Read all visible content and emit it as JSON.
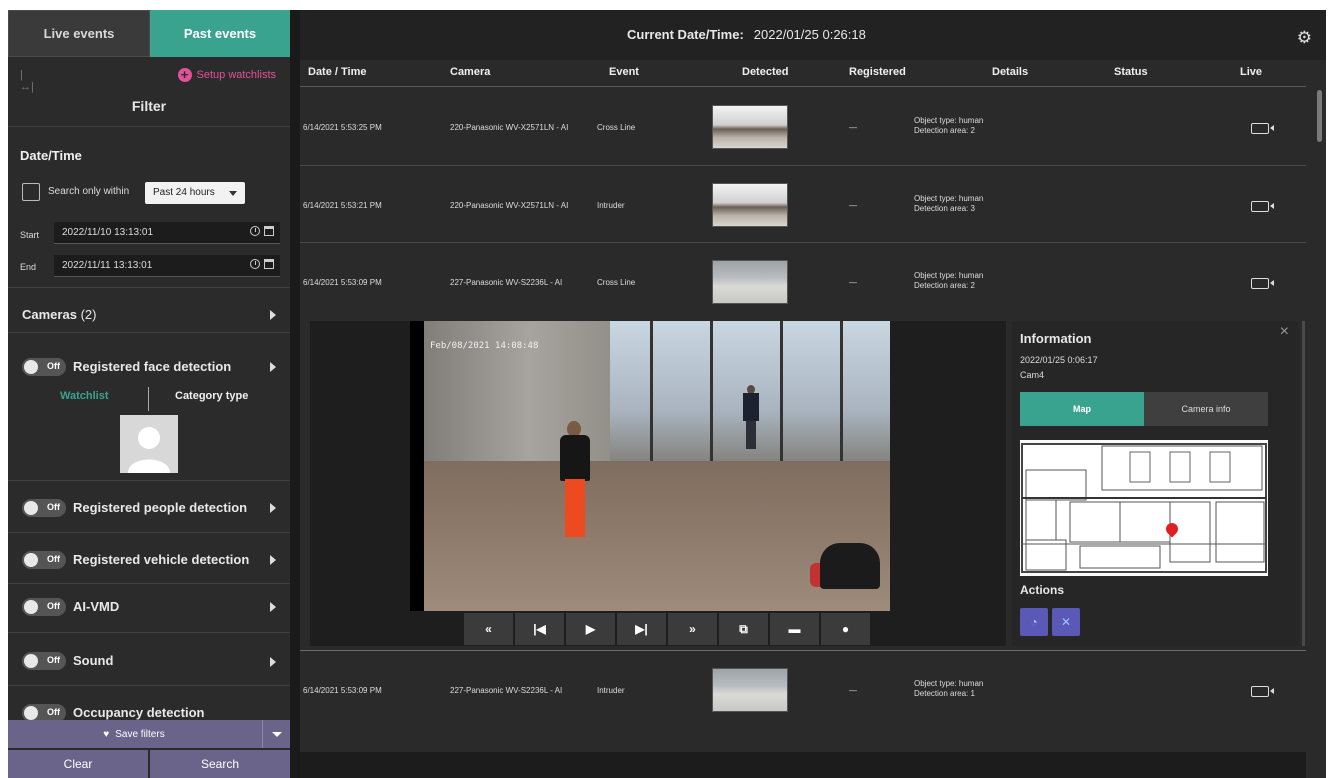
{
  "left": {
    "tabs": {
      "live": "Live events",
      "past": "Past events"
    },
    "setup_watchlists": "Setup watchlists",
    "filter_title": "Filter",
    "datetime": {
      "title": "Date/Time",
      "search_within_label": "Search only within",
      "range_value": "Past 24 hours",
      "start_label": "Start",
      "start_value": "2022/11/10   13:13:01",
      "end_label": "End",
      "end_value": "2022/11/11   13:13:01"
    },
    "cameras": {
      "label": "Cameras",
      "count": "(2)"
    },
    "toggle_off_text": "Off",
    "sections": {
      "face": "Registered face detection",
      "people": "Registered people detection",
      "vehicle": "Registered vehicle detection",
      "aivmd": "AI-VMD",
      "sound": "Sound",
      "occupancy": "Occupancy detection"
    },
    "watchlist_tab": "Watchlist",
    "category_tab": "Category type",
    "save_filters": "Save filters",
    "clear": "Clear",
    "search": "Search",
    "colors": {
      "accent": "#3aa38f",
      "pink": "#e0539a",
      "button": "#6a638a"
    }
  },
  "header": {
    "current_label": "Current Date/Time:",
    "current_value": "2022/01/25 0:26:18"
  },
  "columns": [
    "Date / Time",
    "Camera",
    "Event",
    "Detected",
    "Registered",
    "Details",
    "Status",
    "Live"
  ],
  "rows": [
    {
      "datetime": "6/14/2021 5:53:25 PM",
      "camera": "220-Panasonic WV-X2571LN - AI",
      "event": "Cross Line",
      "registered": "—",
      "details_1": "Object type: human",
      "details_2": "Detection area: 2"
    },
    {
      "datetime": "6/14/2021 5:53:21 PM",
      "camera": "220-Panasonic WV-X2571LN - AI",
      "event": "Intruder",
      "registered": "—",
      "details_1": "Object type: human",
      "details_2": "Detection area: 3"
    },
    {
      "datetime": "6/14/2021 5:53:09 PM",
      "camera": "227-Panasonic WV-S2236L - AI",
      "event": "Cross Line",
      "registered": "—",
      "details_1": "Object type: human",
      "details_2": "Detection area: 2"
    },
    {
      "datetime": "6/14/2021 5:53:09 PM",
      "camera": "227-Panasonic WV-S2236L - AI",
      "event": "Intruder",
      "registered": "—",
      "details_1": "Object type: human",
      "details_2": "Detection area: 1"
    }
  ],
  "video": {
    "timestamp": "Feb/08/2021  14:08:48"
  },
  "player_controls": [
    "«",
    "|◀",
    "▶",
    "▶|",
    "»",
    "⧉",
    "▬",
    "●"
  ],
  "info": {
    "title": "Information",
    "datetime": "2022/01/25 0:06:17",
    "camera": "Cam4",
    "tab_map": "Map",
    "tab_camera": "Camera info",
    "actions_title": "Actions",
    "close": "×"
  },
  "icons": {
    "gear": "gear-icon",
    "live": "video-camera-icon",
    "heart": "heart-icon",
    "plus": "plus-circle-icon",
    "marker": "map-pin-icon"
  }
}
